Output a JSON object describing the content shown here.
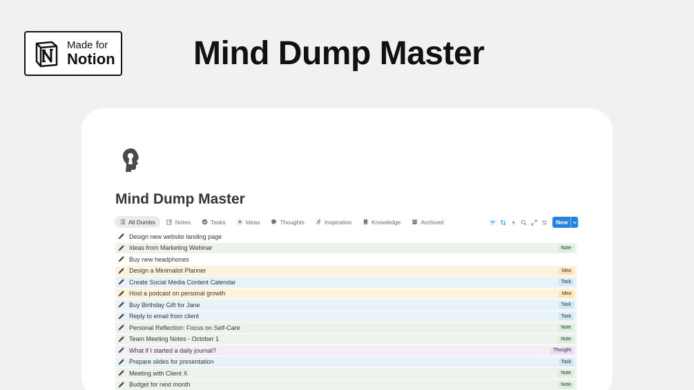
{
  "badge": {
    "line1": "Made for",
    "line2": "Notion",
    "icon": "notion-logo-icon"
  },
  "hero": {
    "title": "Mind Dump Master"
  },
  "page": {
    "title": "Mind Dump Master",
    "icon": "head-keyhole-icon"
  },
  "tabs": [
    {
      "label": "All Dumbs",
      "icon": "list-icon",
      "active": true
    },
    {
      "label": "Notes",
      "icon": "edit-icon",
      "active": false
    },
    {
      "label": "Tasks",
      "icon": "check-circle-icon",
      "active": false
    },
    {
      "label": "Ideas",
      "icon": "sun-icon",
      "active": false
    },
    {
      "label": "Thoughts",
      "icon": "speech-bubble-icon",
      "active": false
    },
    {
      "label": "Inspiration",
      "icon": "run-icon",
      "active": false
    },
    {
      "label": "Knowledge",
      "icon": "book-icon",
      "active": false
    },
    {
      "label": "Archived",
      "icon": "archive-icon",
      "active": false
    }
  ],
  "toolbar": {
    "tools": [
      "filter-icon",
      "sort-icon",
      "lightning-icon",
      "search-icon",
      "expand-icon",
      "settings-sliders-icon"
    ],
    "new_label": "New",
    "accent": "#2383e2"
  },
  "tag_colors": {
    "Note": {
      "bg": "#dbeddb",
      "fg": "#1c3829",
      "row": "#edf3ec"
    },
    "Idea": {
      "bg": "#fbe4b8",
      "fg": "#402c1b",
      "row": "#fbf3db"
    },
    "Task": {
      "bg": "#d3e5ef",
      "fg": "#183347",
      "row": "#e7f3f8"
    },
    "Thought": {
      "bg": "#e8deee",
      "fg": "#412454",
      "row": "#f4eef7"
    }
  },
  "rows": [
    {
      "label": "Design new website landing page",
      "tag": ""
    },
    {
      "label": "Ideas from Marketing Webinar",
      "tag": "Note"
    },
    {
      "label": "Buy new headphones",
      "tag": ""
    },
    {
      "label": "Design a Minimalist Planner",
      "tag": "Idea"
    },
    {
      "label": "Create Social Media Content Calendar",
      "tag": "Task"
    },
    {
      "label": "Host a podcast on personal growth",
      "tag": "Idea"
    },
    {
      "label": "Buy Birthday Gift for Jane",
      "tag": "Task"
    },
    {
      "label": "Reply to email from client",
      "tag": "Task"
    },
    {
      "label": "Personal Reflection: Focus on Self-Care",
      "tag": "Note"
    },
    {
      "label": "Team Meeting Notes - October 1",
      "tag": "Note"
    },
    {
      "label": "What if I started a daily journal?",
      "tag": "Thought"
    },
    {
      "label": "Prepare slides for presentation",
      "tag": "Task"
    },
    {
      "label": "Meeting with Client X",
      "tag": "Note"
    },
    {
      "label": "Budget for next month",
      "tag": "Note"
    }
  ]
}
